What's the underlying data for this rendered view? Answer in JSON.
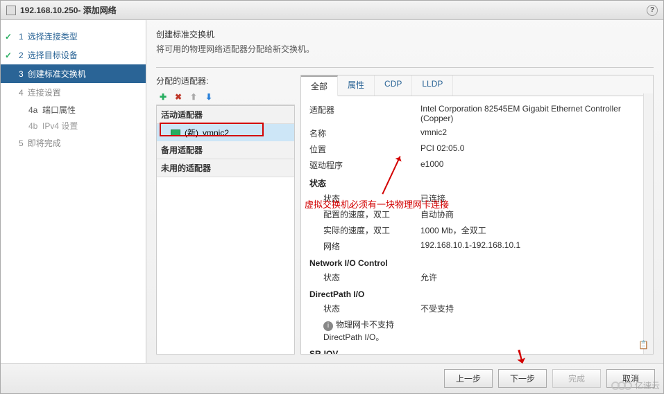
{
  "title": {
    "host": "192.168.10.250",
    "suffix": " - 添加网络"
  },
  "wizard": {
    "steps": [
      {
        "num": "1",
        "label": "选择连接类型",
        "done": true
      },
      {
        "num": "2",
        "label": "选择目标设备",
        "done": true
      },
      {
        "num": "3",
        "label": "创建标准交换机",
        "current": true
      },
      {
        "num": "4",
        "label": "连接设置"
      },
      {
        "num": "5",
        "label": "即将完成"
      }
    ],
    "subs": [
      {
        "id": "4a",
        "label": "端口属性",
        "active": true
      },
      {
        "id": "4b",
        "label": "IPv4 设置",
        "active": false
      }
    ]
  },
  "content": {
    "heading": "创建标准交换机",
    "sub": "将可用的物理网络适配器分配给新交换机。",
    "assigned_label": "分配的适配器:",
    "groups": {
      "active": "活动适配器",
      "standby": "备用适配器",
      "unused": "未用的适配器"
    },
    "adapter": {
      "prefix": "(新)",
      "name": "vmnic2"
    },
    "annotation": "虚拟交换机必须有一块物理网卡连接"
  },
  "tabs": {
    "all": "全部",
    "props": "属性",
    "cdp": "CDP",
    "lldp": "LLDP"
  },
  "props": {
    "adapter_k": "适配器",
    "adapter_v": "Intel Corporation 82545EM Gigabit Ethernet Controller (Copper)",
    "name_k": "名称",
    "name_v": "vmnic2",
    "loc_k": "位置",
    "loc_v": "PCI 02:05.0",
    "drv_k": "驱动程序",
    "drv_v": "e1000",
    "state_section": "状态",
    "state_k": "状态",
    "state_v": "已连接",
    "cfg_k": "配置的速度，双工",
    "cfg_v": "自动协商",
    "act_k": "实际的速度，双工",
    "act_v": "1000 Mb，全双工",
    "net_k": "网络",
    "net_v": "192.168.10.1-192.168.10.1",
    "nio_section": "Network I/O Control",
    "nio_k": "状态",
    "nio_v": "允许",
    "dp_section": "DirectPath I/O",
    "dp_k": "状态",
    "dp_v": "不受支持",
    "dp_note": "物理网卡不支持 DirectPath I/O。",
    "sriov_section": "SR-IOV"
  },
  "footer": {
    "back": "上一步",
    "next": "下一步",
    "finish": "完成",
    "cancel": "取消"
  },
  "watermark": "亿速云"
}
